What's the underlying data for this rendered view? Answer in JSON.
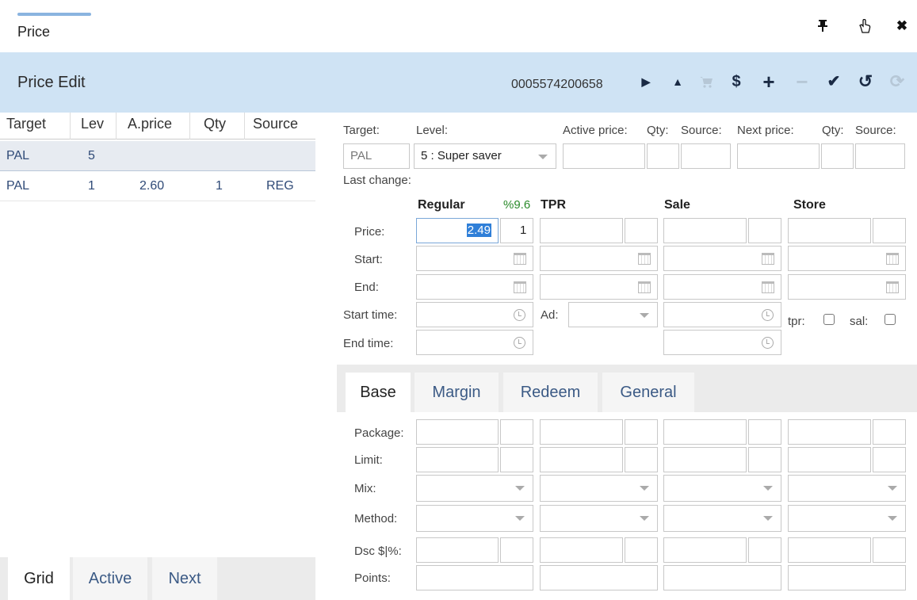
{
  "window": {
    "title": "Price"
  },
  "header": {
    "title": "Price Edit",
    "code": "0005574200658"
  },
  "grid": {
    "columns": [
      "Target",
      "Lev",
      "A.price",
      "Qty",
      "Source"
    ],
    "rows": [
      {
        "target": "PAL",
        "lev": "5",
        "aprice": "",
        "qty": "",
        "source": ""
      },
      {
        "target": "PAL",
        "lev": "1",
        "aprice": "2.60",
        "qty": "1",
        "source": "REG"
      }
    ]
  },
  "left_tabs": [
    "Grid",
    "Active",
    "Next"
  ],
  "top_form": {
    "labels": {
      "target": "Target:",
      "level": "Level:",
      "active_price": "Active price:",
      "qty": "Qty:",
      "source": "Source:",
      "next_price": "Next price:",
      "qty2": "Qty:",
      "source2": "Source:"
    },
    "target_value": "PAL",
    "level_value": "5 : Super saver",
    "last_change_label": "Last change:"
  },
  "columns": {
    "regular": "Regular",
    "regular_pct": "%9.6",
    "tpr": "TPR",
    "sale": "Sale",
    "store": "Store"
  },
  "row_labels": {
    "price": "Price:",
    "start": "Start:",
    "end": "End:",
    "start_time": "Start time:",
    "end_time": "End time:",
    "ad": "Ad:",
    "tpr": "tpr:",
    "sal": "sal:"
  },
  "regular_price": {
    "price": "2.49",
    "qty": "1"
  },
  "bottom_tabs": [
    "Base",
    "Margin",
    "Redeem",
    "General"
  ],
  "base_labels": {
    "package": "Package:",
    "limit": "Limit:",
    "mix": "Mix:",
    "method": "Method:",
    "dsc": "Dsc $|%:",
    "points": "Points:"
  },
  "colors": {
    "header_bg": "#cfe3f4",
    "accent": "#2f4a77",
    "pct_green": "#2a8a2a",
    "selected_text_bg": "#2f7fd8"
  },
  "icons": [
    "pin-icon",
    "pointer-icon",
    "close-icon",
    "play-icon",
    "caret-up-icon",
    "cart-icon",
    "dollar-icon",
    "plus-icon",
    "minus-icon",
    "check-icon",
    "undo-icon",
    "refresh-icon",
    "calendar-icon",
    "clock-icon"
  ]
}
